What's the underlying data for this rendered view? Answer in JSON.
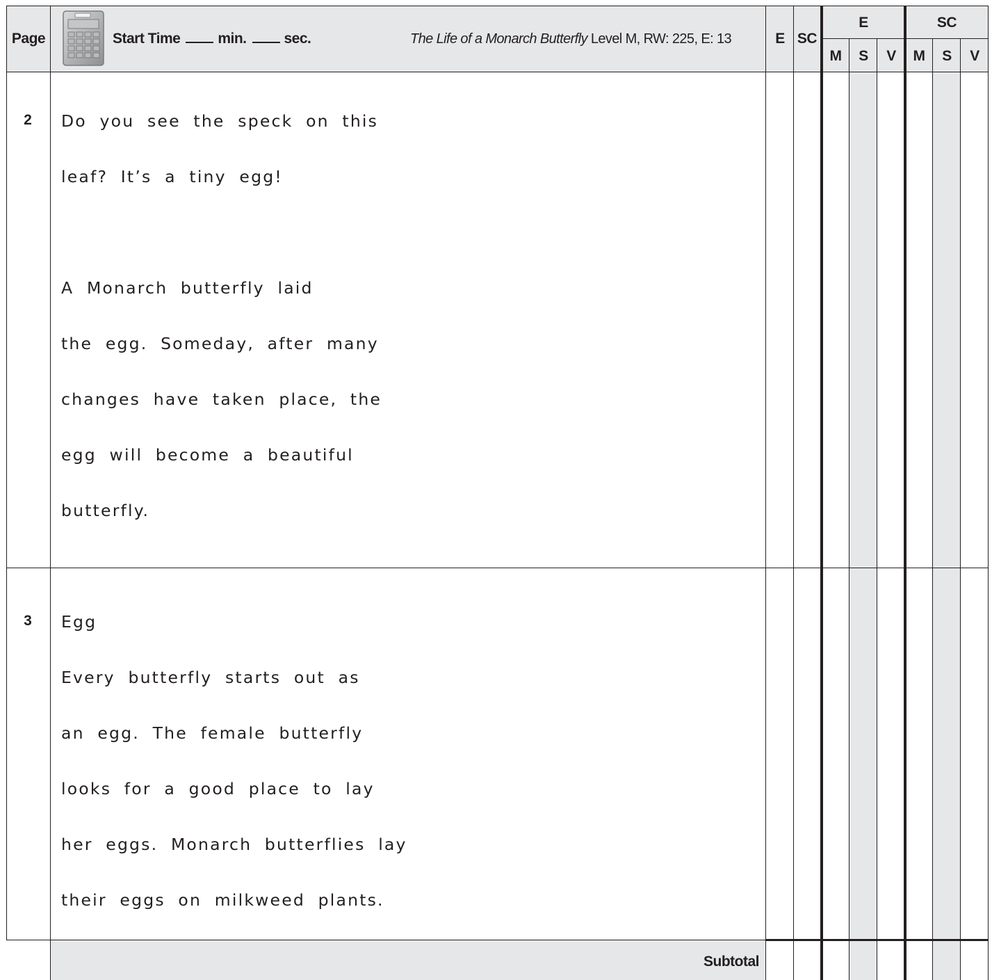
{
  "header": {
    "page_label": "Page",
    "start_time_label": "Start Time",
    "min_label": "min.",
    "sec_label": "sec.",
    "book_title": "The Life of a Monarch Butterfly",
    "book_meta": " Level  M, RW: 225, E: 13",
    "col_e": "E",
    "col_sc": "SC",
    "group_e": "E",
    "group_sc": "SC",
    "msv": [
      "M",
      "S",
      "V",
      "M",
      "S",
      "V"
    ]
  },
  "pages": [
    {
      "number": "2",
      "lines": [
        "Do you see the speck on this",
        "leaf? It’s a tiny egg!",
        "A Monarch butterfly laid",
        "the egg. Someday, after many",
        "changes have taken place, the",
        "egg will become a beautiful",
        "butterfly."
      ]
    },
    {
      "number": "3",
      "lines": [
        "Egg",
        "Every butterfly starts out as",
        "an egg. The female butterfly",
        "looks for a good place to lay",
        "her eggs. Monarch butterflies lay",
        "their eggs on milkweed plants."
      ]
    }
  ],
  "footer": {
    "subtotal_label": "Subtotal"
  },
  "icons": {
    "timer": "calculator-icon"
  }
}
